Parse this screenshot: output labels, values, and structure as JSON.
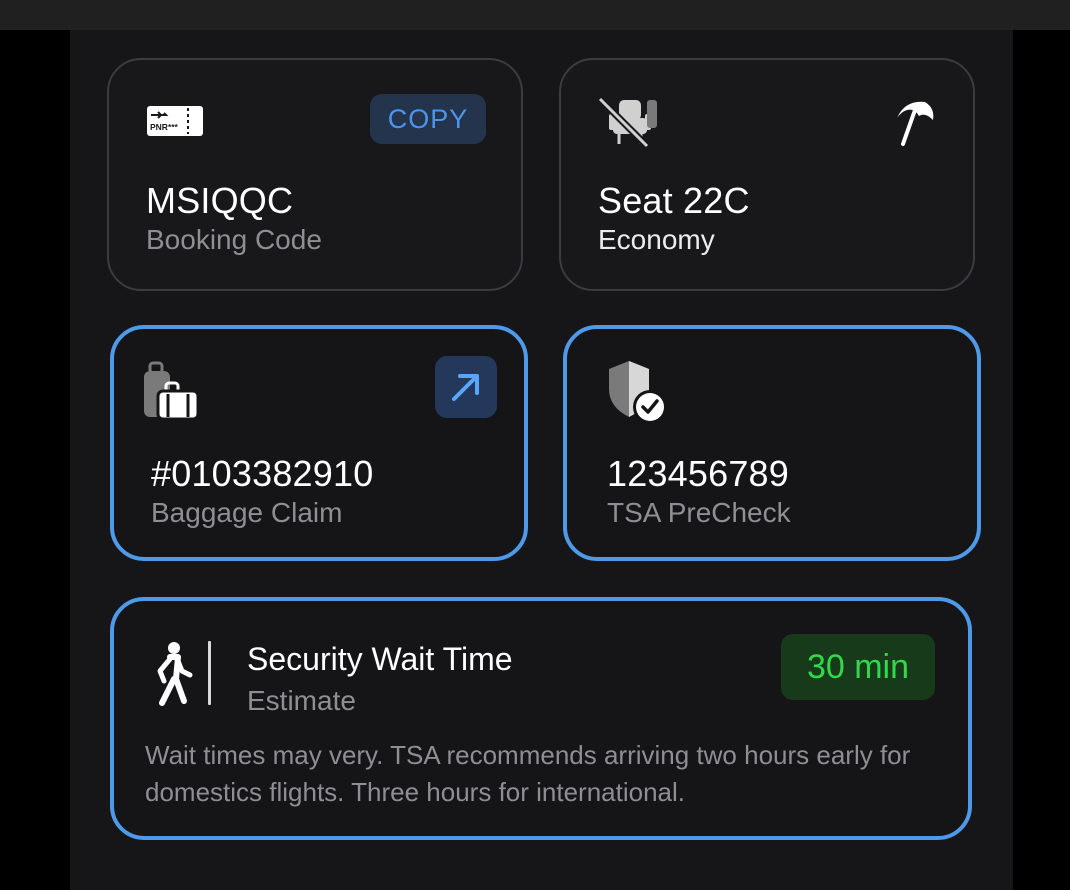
{
  "booking": {
    "icon": "boarding-pass-icon",
    "icon_text": "PNR***",
    "copy_label": "COPY",
    "code": "MSIQQC",
    "label": "Booking Code"
  },
  "seat": {
    "icon": "seat-unavailable-icon",
    "icon2": "beach-umbrella-icon",
    "value": "Seat 22C",
    "label": "Economy"
  },
  "baggage": {
    "icon": "luggage-icon",
    "open_icon": "arrow-up-right-icon",
    "value": "#0103382910",
    "label": "Baggage Claim"
  },
  "tsa": {
    "icon": "shield-check-icon",
    "value": "123456789",
    "label": "TSA PreCheck"
  },
  "security": {
    "icon": "walking-person-icon",
    "title": "Security Wait Time",
    "subtitle": "Estimate",
    "badge": "30 min",
    "note": "Wait times may very. TSA recommends arriving two hours early for domestics flights. Three hours for international."
  },
  "colors": {
    "accent_border": "#4f9ae8",
    "copy_button_text": "#4c94ec",
    "wait_badge_text": "#32d74b",
    "wait_badge_bg": "#173a1b"
  }
}
